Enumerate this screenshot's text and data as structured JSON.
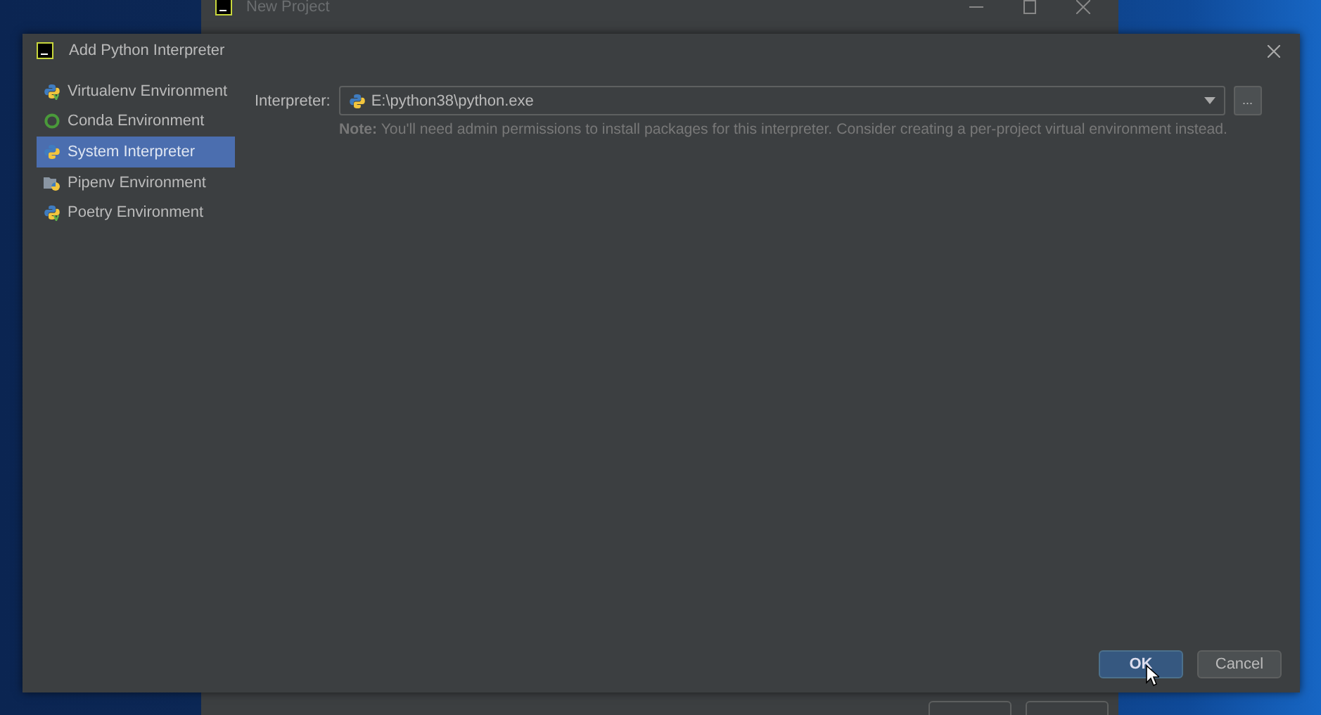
{
  "parent_window": {
    "title": "New Project"
  },
  "dialog": {
    "title": "Add Python Interpreter"
  },
  "sidebar": {
    "items": [
      {
        "label": "Virtualenv Environment",
        "kind": "virtualenv",
        "selected": false
      },
      {
        "label": "Conda Environment",
        "kind": "conda",
        "selected": false
      },
      {
        "label": "System Interpreter",
        "kind": "system",
        "selected": true
      },
      {
        "label": "Pipenv Environment",
        "kind": "pipenv",
        "selected": false
      },
      {
        "label": "Poetry Environment",
        "kind": "poetry",
        "selected": false
      }
    ]
  },
  "interpreter": {
    "label": "Interpreter:",
    "value": "E:\\python38\\python.exe",
    "browse": "..."
  },
  "note": "**Note:** You'll need admin permissions to install packages for this interpreter. Consider creating a per-project virtual environment instead.",
  "buttons": [
    {
      "label": "OK",
      "primary": true
    },
    {
      "label": "Cancel",
      "primary": false
    }
  ]
}
